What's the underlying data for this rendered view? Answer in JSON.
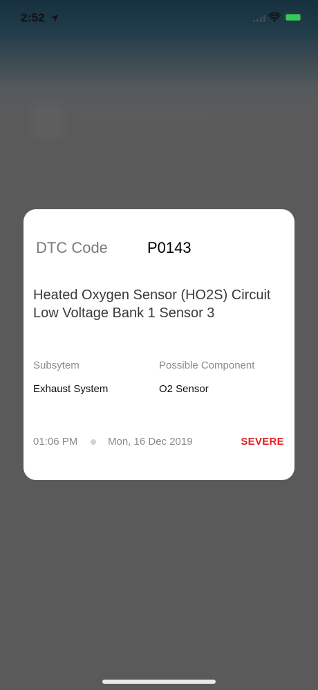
{
  "status_bar": {
    "time": "2:52"
  },
  "card": {
    "dtc_label": "DTC Code",
    "dtc_code": "P0143",
    "description": "Heated Oxygen Sensor (HO2S) Circuit Low Voltage Bank 1 Sensor 3",
    "subsystem_label": "Subsytem",
    "subsystem_value": "Exhaust System",
    "component_label": "Possible Component",
    "component_value": "O2 Sensor",
    "time": "01:06 PM",
    "date": "Mon, 16 Dec 2019",
    "severity": "SEVERE"
  },
  "colors": {
    "scrim": "#5a5a5a",
    "card_background": "#ffffff",
    "severity": "#e02020",
    "battery": "#34c759"
  },
  "icons": [
    "location-arrow-icon",
    "cellular-signal-icon",
    "wifi-icon",
    "battery-icon"
  ]
}
